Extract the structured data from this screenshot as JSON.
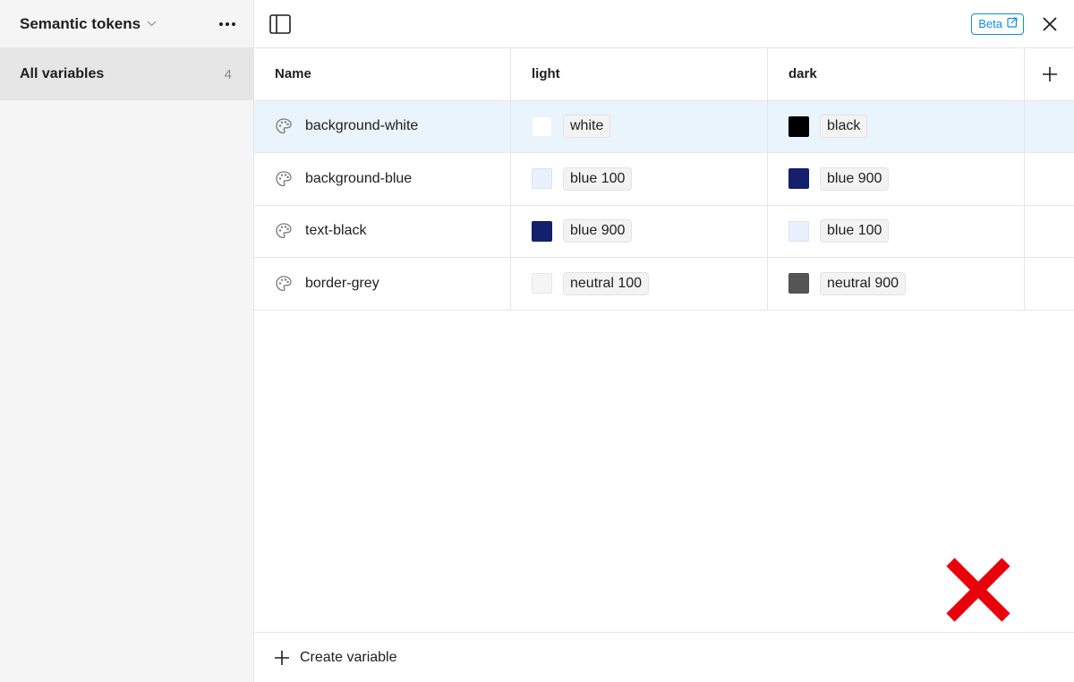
{
  "sidebar": {
    "collection_title": "Semantic tokens",
    "groups": [
      {
        "label": "All variables",
        "count": "4"
      }
    ]
  },
  "topbar": {
    "beta_label": "Beta"
  },
  "table": {
    "columns": [
      "Name",
      "light",
      "dark"
    ],
    "rows": [
      {
        "name": "background-white",
        "light": {
          "label": "white",
          "color": "#ffffff"
        },
        "dark": {
          "label": "black",
          "color": "#000000"
        },
        "selected": true
      },
      {
        "name": "background-blue",
        "light": {
          "label": "blue 100",
          "color": "#e8f1fd"
        },
        "dark": {
          "label": "blue 900",
          "color": "#14206e"
        }
      },
      {
        "name": "text-black",
        "light": {
          "label": "blue 900",
          "color": "#14206e"
        },
        "dark": {
          "label": "blue 100",
          "color": "#e8f1fd"
        }
      },
      {
        "name": "border-grey",
        "light": {
          "label": "neutral 100",
          "color": "#f5f5f5"
        },
        "dark": {
          "label": "neutral 900",
          "color": "#555555"
        }
      }
    ]
  },
  "footer": {
    "create_label": "Create variable"
  },
  "colors": {
    "accent": "#0d8ce9",
    "selected_row": "#e9f4fd",
    "annotation_x": "#e8000b"
  },
  "icons": [
    "chevron-down-icon",
    "more-icon",
    "sidebar-toggle-icon",
    "external-link-icon",
    "close-icon",
    "plus-icon",
    "palette-icon",
    "red-x-mark-icon"
  ]
}
